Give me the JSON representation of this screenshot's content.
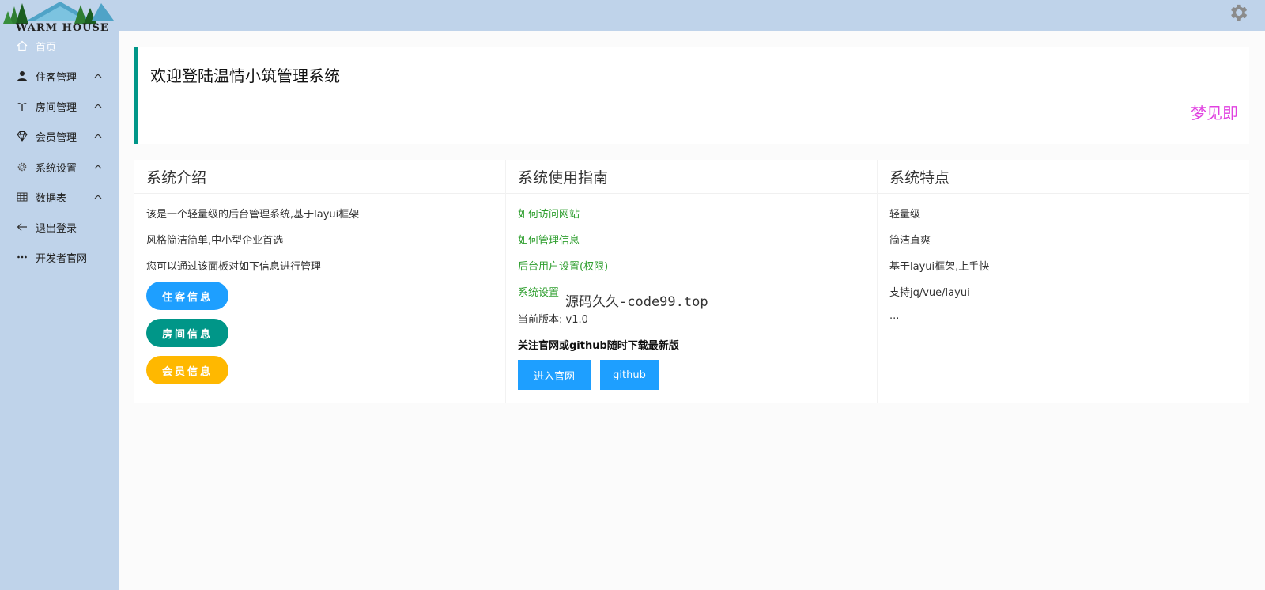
{
  "logo": {
    "text": "WARM HOUSE"
  },
  "topbar": {
    "settings_icon": "gear-icon"
  },
  "sidebar": {
    "items": [
      {
        "label": "首页",
        "icon": "home-icon"
      },
      {
        "label": "住客管理",
        "icon": "user-icon"
      },
      {
        "label": "房间管理",
        "icon": "palm-tree-icon"
      },
      {
        "label": "会员管理",
        "icon": "diamond-icon"
      },
      {
        "label": "系统设置",
        "icon": "gear-icon"
      },
      {
        "label": "数据表",
        "icon": "table-icon"
      },
      {
        "label": "退出登录",
        "icon": "arrow-left-icon"
      },
      {
        "label": "开发者官网",
        "icon": "more-icon"
      }
    ]
  },
  "welcome": {
    "title": "欢迎登陆温情小筑管理系统",
    "marquee": "梦见即"
  },
  "intro": {
    "title": "系统介绍",
    "lines": [
      "该是一个轻量级的后台管理系统,基于layui框架",
      "风格简洁简单,中小型企业首选",
      "您可以通过该面板对如下信息进行管理"
    ],
    "buttons": [
      "住客信息",
      "房间信息",
      "会员信息"
    ]
  },
  "guide": {
    "title": "系统使用指南",
    "links": [
      "如何访问网站",
      "如何管理信息",
      "后台用户设置(权限)",
      "系统设置"
    ],
    "watermark": "源码久久-code99.top",
    "version": "当前版本: v1.0",
    "notice": "关注官网或github随时下载最新版",
    "buttons": [
      "进入官网",
      "github"
    ]
  },
  "features": {
    "title": "系统特点",
    "lines": [
      "轻量级",
      "简洁直爽",
      "基于layui框架,上手快",
      "支持jq/vue/layui",
      "..."
    ]
  },
  "colors": {
    "sidebar_bg": "#bfd3ea",
    "accent_teal": "#009688",
    "accent_blue": "#1e9fff",
    "accent_yellow": "#ffb800",
    "link_green": "#2e9e2e",
    "marquee_pink": "#e040e0"
  }
}
